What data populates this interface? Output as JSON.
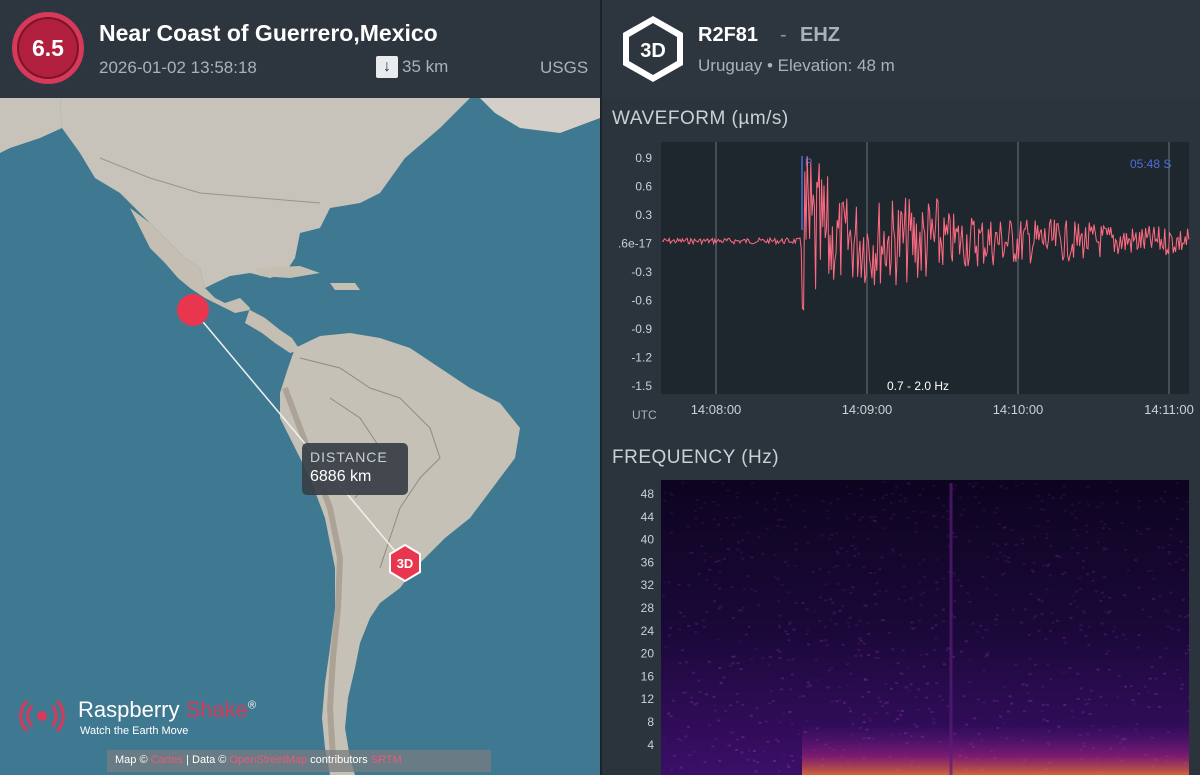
{
  "event": {
    "magnitude": "6.5",
    "title": "Near Coast of Guerrero,Mexico",
    "datetime": "2026-01-02 13:58:18",
    "depth": "35 km",
    "source": "USGS"
  },
  "map": {
    "distance_label": "DISTANCE",
    "distance_value": "6886 km",
    "station_marker": "3D",
    "brand": {
      "name_a": "Raspberry ",
      "name_b": "Shake",
      "reg": "®",
      "tagline": "Watch the Earth Move"
    },
    "attribution": {
      "prefix": "Map © ",
      "maps_link": "Cartes",
      "data": " | Data © ",
      "osm_link": "OpenStreetMap",
      "contrib": " contributors ",
      "srtm_link": "SRTM"
    }
  },
  "station": {
    "badge": "3D",
    "code": "R2F81",
    "separator": "-",
    "channel": "EHZ",
    "subtitle": "Uruguay • Elevation: 48 m"
  },
  "waveform": {
    "title": "WAVEFORM (µm/s)",
    "filter": "0.7 - 2.0 Hz",
    "p_label": "P",
    "s_label": "05:48  S",
    "utc_label": "UTC",
    "y_ticks": [
      "0.9",
      "0.6",
      "0.3",
      ".6e-17",
      "-0.3",
      "-0.6",
      "-0.9",
      "-1.2",
      "-1.5"
    ],
    "x_ticks": [
      "14:08:00",
      "14:09:00",
      "14:10:00",
      "14:11:00"
    ],
    "colors": {
      "trace": "#ff6b82",
      "phase": "#4a6fd6",
      "grid": "#6b747c"
    }
  },
  "frequency": {
    "title": "FREQUENCY (Hz)",
    "y_ticks": [
      "48",
      "44",
      "40",
      "36",
      "32",
      "28",
      "24",
      "20",
      "16",
      "12",
      "8",
      "4"
    ]
  },
  "colors": {
    "accent": "#d6395a",
    "marker": "#e8364f",
    "ocean": "#3d7690",
    "land": "#c9c4bb"
  }
}
